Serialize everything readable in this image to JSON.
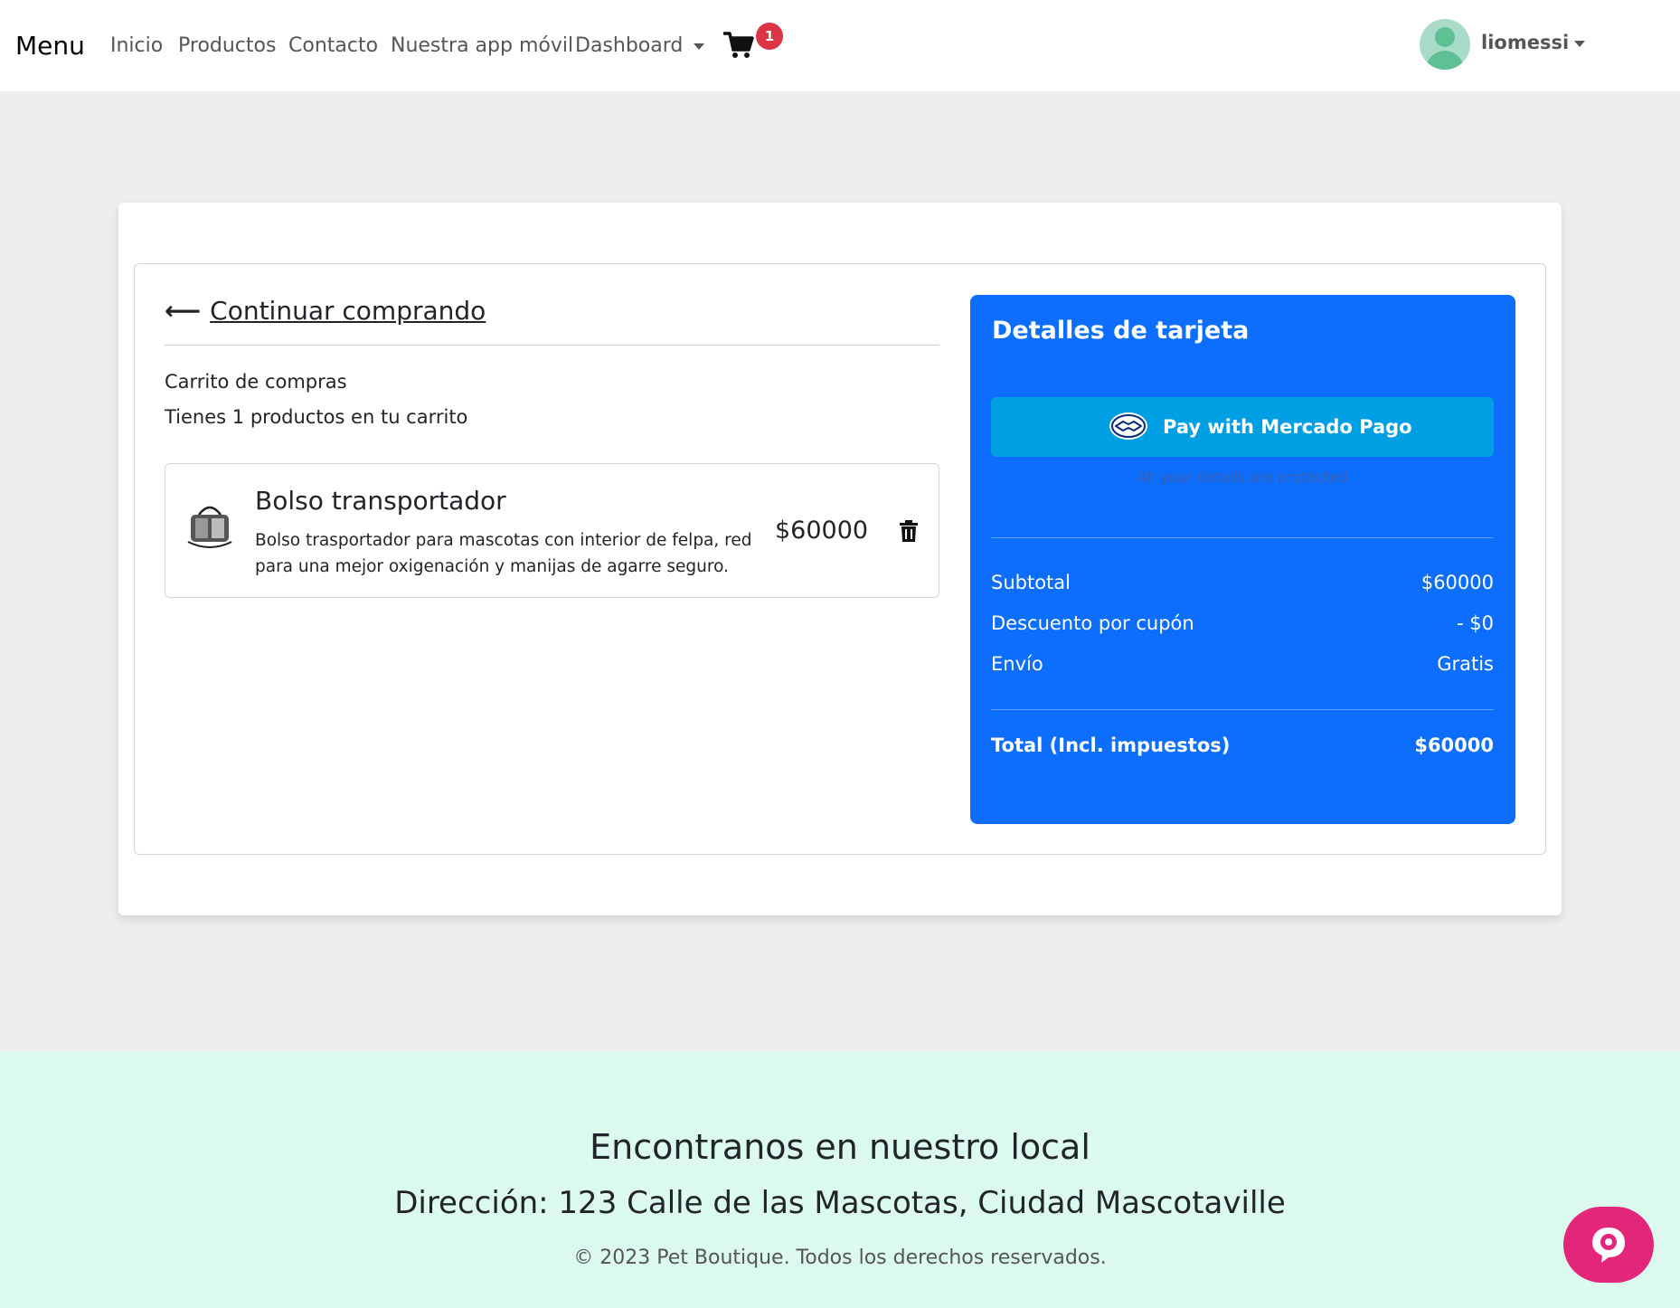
{
  "navbar": {
    "brand": "Menu",
    "links": [
      "Inicio",
      "Productos",
      "Contacto",
      "Nuestra app móvil"
    ],
    "dashboard": "Dashboard",
    "cart_count": "1",
    "username": "liomessi"
  },
  "cart": {
    "back_link": "Continuar comprando",
    "title": "Carrito de compras",
    "count_text": "Tienes 1 productos en tu carrito",
    "items": [
      {
        "name": "Bolso transportador",
        "description": "Bolso trasportador para mascotas con interior de felpa, red para una mejor oxigenación y manijas de agarre seguro.",
        "price": "$60000"
      }
    ]
  },
  "payment": {
    "title": "Detalles de tarjeta",
    "button_label": "Pay with Mercado Pago",
    "note": "All your details are protected",
    "rows": [
      {
        "label": "Subtotal",
        "value": "$60000"
      },
      {
        "label": "Descuento por cupón",
        "value": "- $0"
      },
      {
        "label": "Envío",
        "value": "Gratis"
      }
    ],
    "total_label": "Total (Incl. impuestos)",
    "total_value": "$60000"
  },
  "footer": {
    "title": "Encontranos en nuestro local",
    "address": "Dirección: 123 Calle de las Mascotas, Ciudad Mascotaville",
    "copyright": "© 2023 Pet Boutique. Todos los derechos reservados."
  },
  "colors": {
    "primary": "#0d6efd",
    "mercado_pago": "#009ee3",
    "badge": "#dc3545",
    "footer_bg": "#dbf9ee",
    "chat": "#e3267a"
  },
  "icons": [
    "cart-icon",
    "user-avatar-icon",
    "arrow-left-icon",
    "trash-icon",
    "mercado-pago-handshake-icon",
    "chat-bot-icon"
  ]
}
